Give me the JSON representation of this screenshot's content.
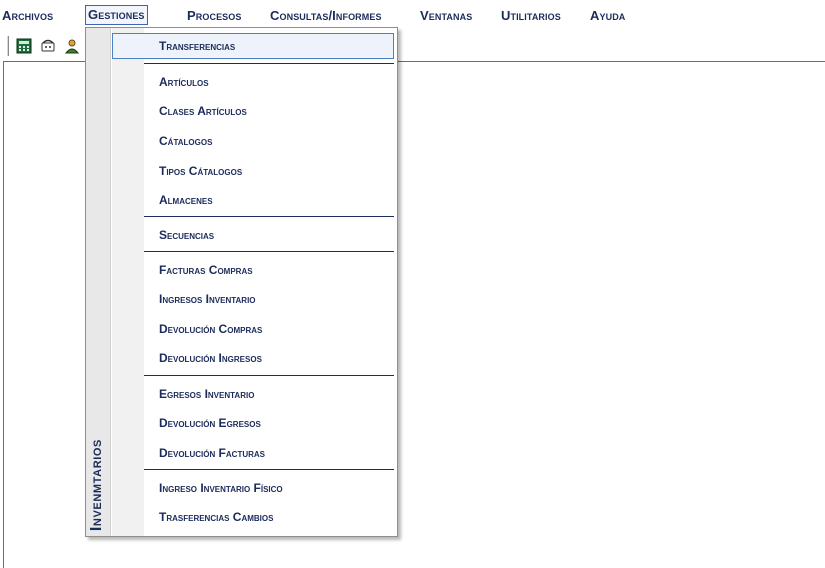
{
  "menubar": {
    "items": [
      {
        "label": "Archivos"
      },
      {
        "label": "Gestiones"
      },
      {
        "label": "Procesos"
      },
      {
        "label": "Consultas/Informes"
      },
      {
        "label": "Ventanas"
      },
      {
        "label": "Utilitarios"
      },
      {
        "label": "Ayuda"
      }
    ]
  },
  "toolbar": {
    "buttons": [
      {
        "icon": "calculator-icon"
      },
      {
        "icon": "phone-icon"
      },
      {
        "icon": "person-icon"
      }
    ]
  },
  "dropdown": {
    "side_title": "Invenmtarios",
    "items": [
      {
        "label": "Transferencias"
      },
      {
        "label": "Artículos"
      },
      {
        "label": "Clases Artículos"
      },
      {
        "label": "Cátalogos"
      },
      {
        "label": "Tipos Cátalogos"
      },
      {
        "label": "Almacenes"
      },
      {
        "label": "Secuencias"
      },
      {
        "label": "Facturas Compras"
      },
      {
        "label": "Ingresos Inventario"
      },
      {
        "label": "Devolución Compras"
      },
      {
        "label": "Devolución Ingresos"
      },
      {
        "label": "Egresos Inventario"
      },
      {
        "label": "Devolución Egresos"
      },
      {
        "label": "Devolución Facturas"
      },
      {
        "label": "Ingreso Inventario Físico"
      },
      {
        "label": "Trasferencias Cambios"
      }
    ]
  },
  "colors": {
    "menu_text": "#1b2b5a",
    "highlight_border": "#4d7fc4",
    "highlight_fill": "#eef3fb",
    "separator": "#1b2b5a"
  }
}
